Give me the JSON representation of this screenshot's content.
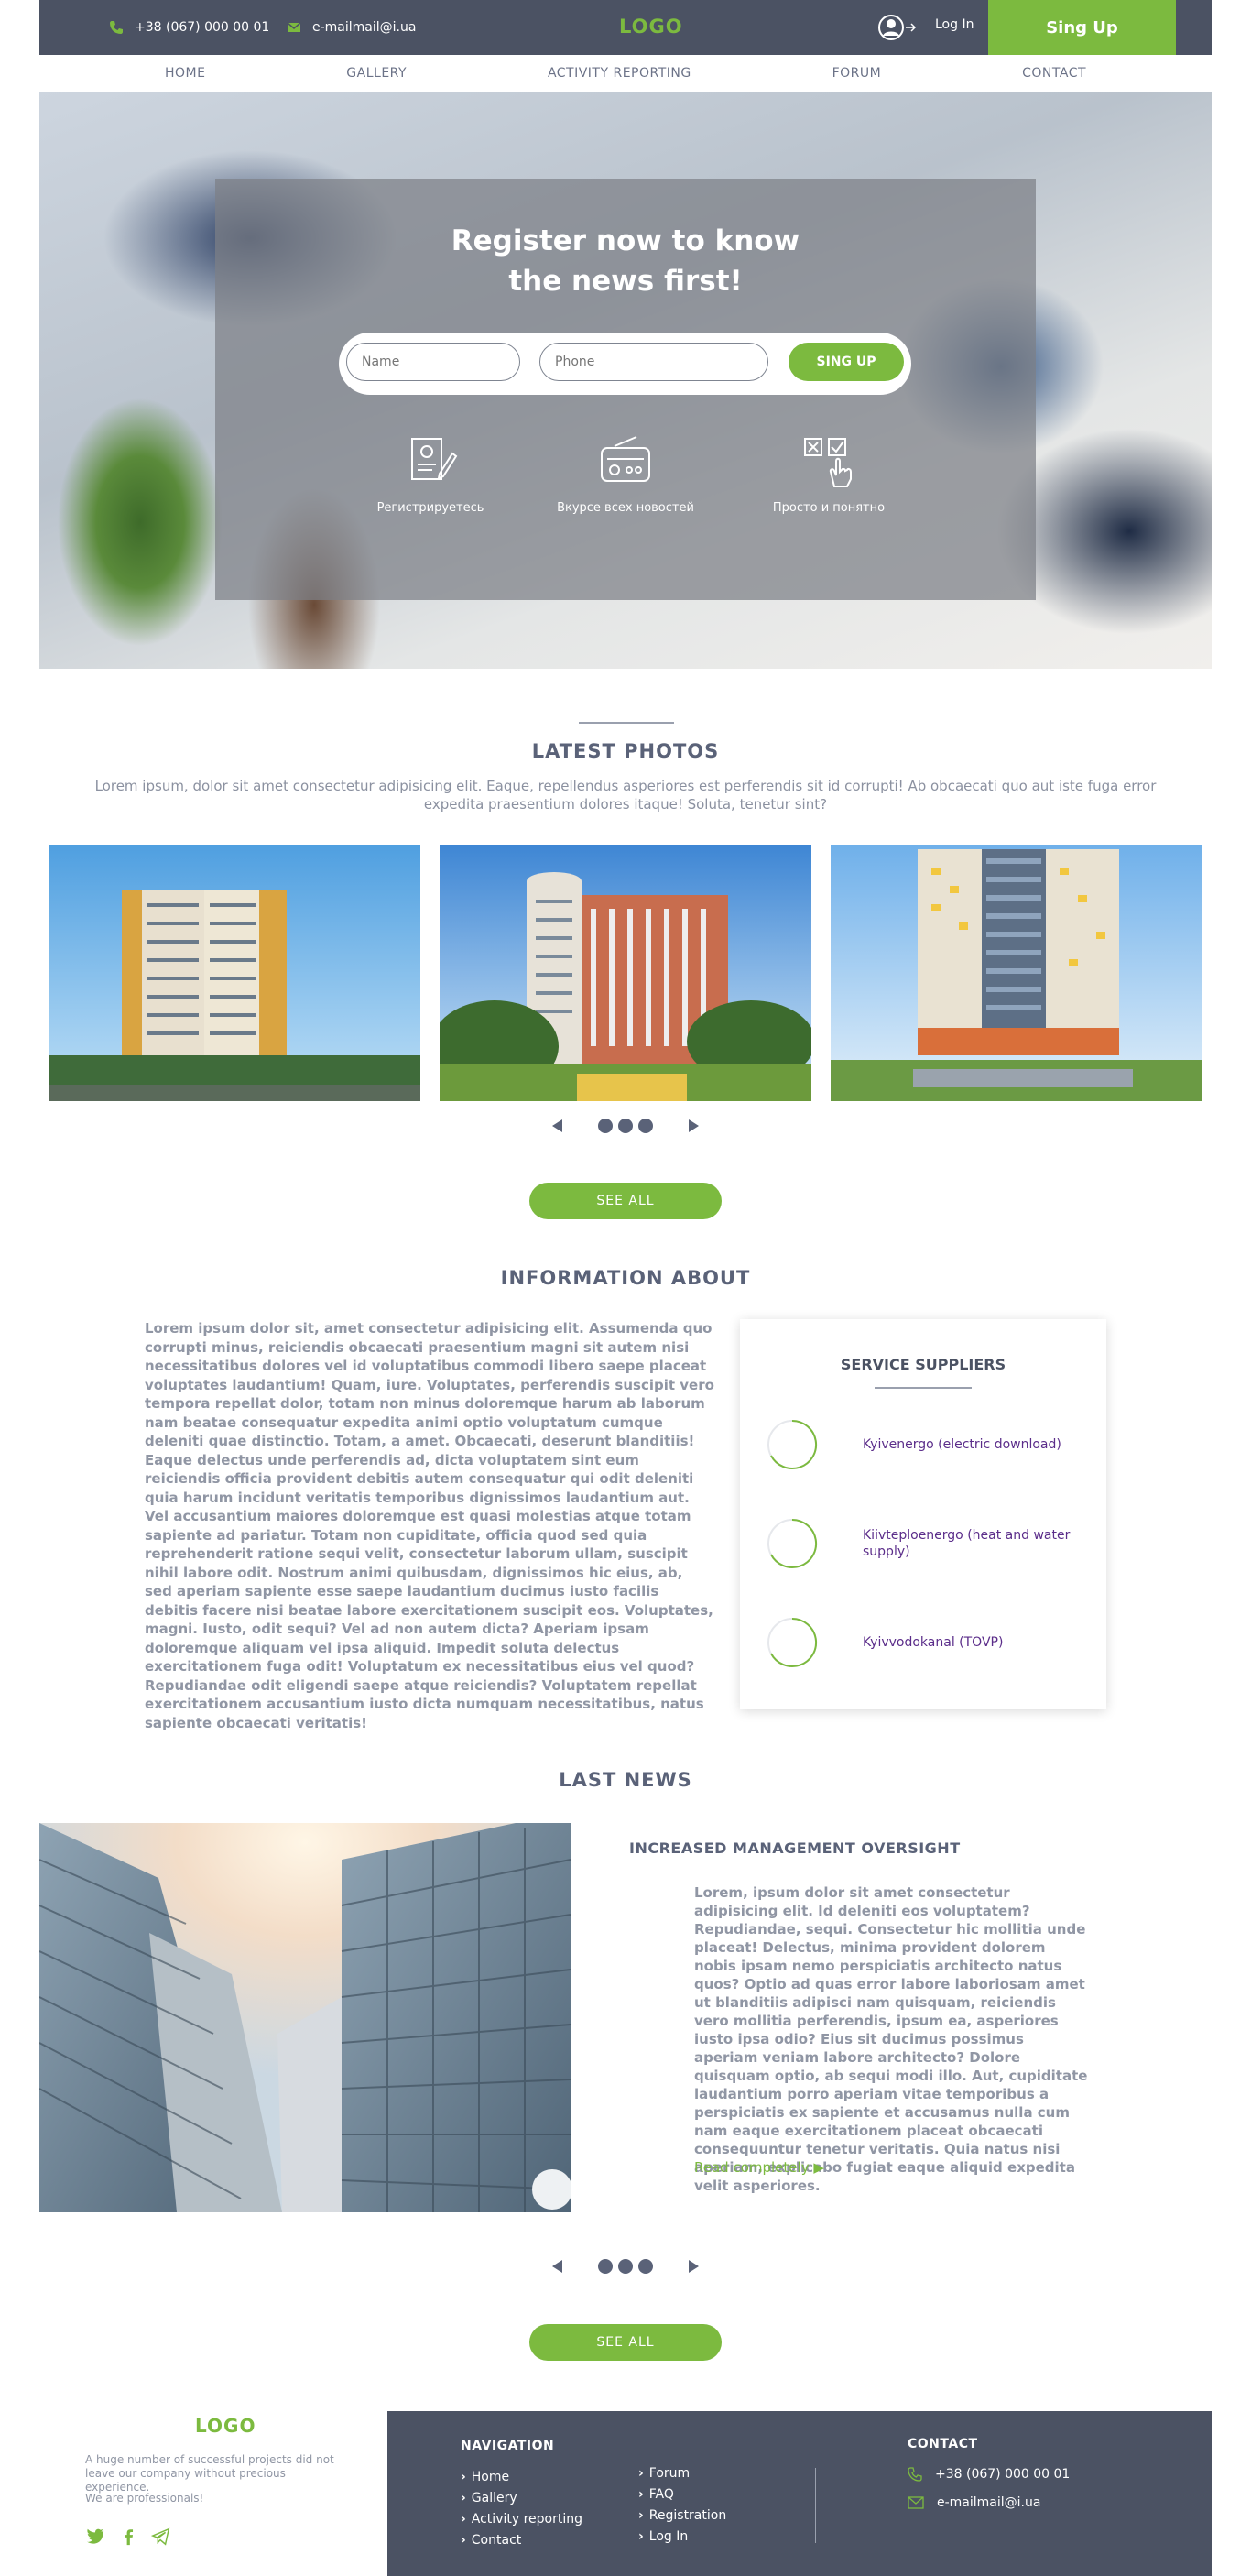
{
  "topbar": {
    "phone": "+38 (067) 000 00 01",
    "email": "e-mailmail@i.ua",
    "logo": "LOGO",
    "login": "Log In",
    "signup": "Sing Up"
  },
  "nav": [
    "HOME",
    "GALLERY",
    "ACTIVITY REPORTING",
    "FORUM",
    "CONTACT"
  ],
  "hero": {
    "title_line1": "Register now to know",
    "title_line2": "the news first!",
    "name_placeholder": "Name",
    "phone_placeholder": "Phone",
    "submit": "SING UP",
    "features": [
      "Регистрируетесь",
      "Вкурсе всех новостей",
      "Просто и понятно"
    ]
  },
  "photos": {
    "title": "LATEST PHOTOS",
    "lead": "Lorem ipsum, dolor sit amet consectetur adipisicing elit. Eaque, repellendus asperiores est perferendis sit id corrupti! Ab obcaecati quo aut iste fuga error expedita praesentium dolores itaque! Soluta, tenetur sint?",
    "see_all": "SEE ALL"
  },
  "info": {
    "title": "INFORMATION ABOUT",
    "text": "Lorem ipsum dolor sit, amet consectetur adipisicing elit. Assumenda quo corrupti minus, reiciendis obcaecati praesentium magni sit autem nisi necessitatibus dolores vel id voluptatibus commodi libero saepe placeat voluptates laudantium! Quam, iure. Voluptates, perferendis suscipit vero tempora repellat dolor, totam non minus doloremque harum ab laborum nam beatae consequatur expedita animi optio voluptatum cumque deleniti quae distinctio. Totam, a amet. Obcaecati, deserunt blanditiis! Eaque delectus unde perferendis ad, dicta voluptatem sint eum reiciendis officia provident debitis autem consequatur qui odit deleniti quia harum incidunt veritatis temporibus dignissimos laudantium aut. Vel accusantium maiores doloremque est quasi molestias atque totam sapiente ad pariatur. Totam non cupiditate, officia quod sed quia reprehenderit ratione sequi velit, consectetur laborum ullam, suscipit nihil labore odit. Nostrum animi quibusdam, dignissimos hic eius, ab, sed aperiam sapiente esse saepe laudantium ducimus iusto facilis debitis facere nisi beatae labore exercitationem suscipit eos. Voluptates, magni. Iusto, odit sequi? Vel ad non autem dicta? Aperiam ipsam doloremque aliquam vel ipsa aliquid. Impedit soluta delectus exercitationem fuga odit! Voluptatum ex necessitatibus eius vel quod? Repudiandae odit eligendi saepe atque reiciendis? Voluptatem repellat exercitationem accusantium iusto dicta numquam necessitatibus, natus sapiente obcaecati veritatis!",
    "card_title": "SERVICE SUPPLIERS",
    "suppliers": [
      "Kyivenergo (electric download)",
      "Kiivteploenergo (heat and water supply)",
      "Kyivvodokanal (TOVP)"
    ]
  },
  "news": {
    "title": "LAST NEWS",
    "headline": "INCREASED MANAGEMENT OVERSIGHT",
    "text": "Lorem, ipsum dolor sit amet consectetur adipisicing elit. Id deleniti eos voluptatem? Repudiandae, sequi. Consectetur hic mollitia unde placeat! Delectus, minima provident dolorem nobis ipsam nemo perspiciatis architecto natus quos? Optio ad quas error labore laboriosam amet ut blanditiis adipisci nam quisquam, reiciendis vero mollitia perferendis, ipsum ea, asperiores iusto ipsa odio? Eius sit ducimus possimus aperiam veniam labore architecto? Dolore quisquam optio, ab sequi modi illo. Aut, cupiditate laudantium porro aperiam vitae temporibus a perspiciatis ex sapiente et accusamus nulla cum nam eaque exercitationem placeat obcaecati consequuntur tenetur veritatis. Quia natus nisi aperiam, explicabo fugiat eaque aliquid expedita velit asperiores.",
    "read_more": "Read completely ▶",
    "see_all": "SEE ALL"
  },
  "footer": {
    "logo": "LOGO",
    "tagline": "A huge number of successful projects did not leave our company without precious experience.",
    "pro": "We are professionals!",
    "nav_title": "NAVIGATION",
    "nav_col1": [
      "Home",
      "Gallery",
      "Activity reporting",
      "Contact"
    ],
    "nav_col2": [
      "Forum",
      "FAQ",
      "Registration",
      "Log In"
    ],
    "contact_title": "CONTACT",
    "phone": "+38 (067) 000 00 01",
    "email": "e-mailmail@i.ua"
  },
  "colors": {
    "accent": "#7cba3f",
    "dark": "#4b5263",
    "text": "#5a6278",
    "link": "#5b2d8a"
  },
  "icons": [
    "phone-icon",
    "mail-icon",
    "user-icon",
    "form-icon",
    "radio-icon",
    "checklist-icon",
    "twitter-icon",
    "facebook-icon",
    "telegram-icon"
  ]
}
